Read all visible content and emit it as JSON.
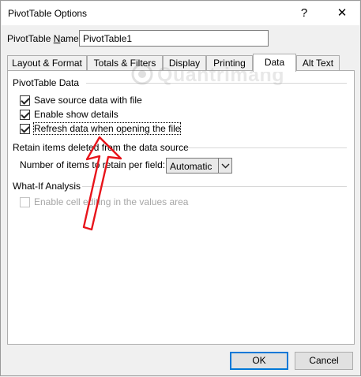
{
  "window": {
    "title": "PivotTable Options",
    "help_glyph": "?",
    "close_glyph": "✕"
  },
  "name_field": {
    "label_prefix": "PivotTable ",
    "label_accel": "N",
    "label_suffix": "ame:",
    "value": "PivotTable1"
  },
  "tabs": [
    {
      "label": "Layout & Format"
    },
    {
      "label": "Totals & Filters"
    },
    {
      "label": "Display"
    },
    {
      "label": "Printing"
    },
    {
      "label": "Data",
      "active": true
    },
    {
      "label": "Alt Text"
    }
  ],
  "groups": {
    "pivot_data": {
      "title": "PivotTable Data",
      "items": [
        {
          "label": "Save source data with file",
          "checked": true
        },
        {
          "label": "Enable show details",
          "checked": true
        },
        {
          "label": "Refresh data when opening the file",
          "checked": true
        }
      ]
    },
    "retain": {
      "title": "Retain items deleted from the data source",
      "field_label": "Number of items to retain per field:",
      "selected": "Automatic"
    },
    "what_if": {
      "title": "What-If Analysis",
      "items": [
        {
          "label": "Enable cell editing in the values area",
          "checked": false,
          "disabled": true
        }
      ]
    }
  },
  "buttons": {
    "ok": "OK",
    "cancel": "Cancel"
  },
  "watermark": {
    "text": "Quantrimang"
  },
  "colors": {
    "annotation_arrow": "#e8141b",
    "default_button_border": "#0078d7"
  }
}
